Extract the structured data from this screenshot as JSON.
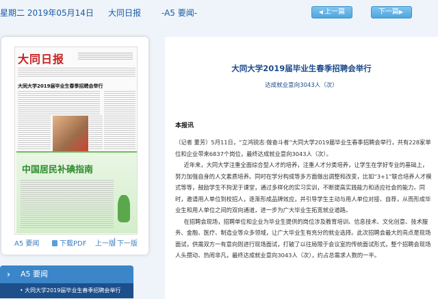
{
  "topbar": {
    "date": "星期二 2019年05月14日",
    "paper": "大同日报",
    "section": "-A5 要闻-",
    "prev_label": "上一篇",
    "next_label": "下一篇"
  },
  "thumbnail": {
    "masthead": "大同日报",
    "headline": "大同大学2019届毕业生春季招聘会举行",
    "ad_title": "中国居民补碘指南",
    "section_link": "A5 要闻",
    "pdf_link": "下载PDF",
    "prev_page": "上一版",
    "next_page": "下一版"
  },
  "section_list": {
    "header": "A5 要闻",
    "items": [
      "大同大学2019届毕业生春季招聘会举行"
    ]
  },
  "article": {
    "title": "大同大学2019届毕业生春季招聘会举行",
    "subtitle": "达成就业意向3043人（次）",
    "intro_label": "本报讯",
    "paragraphs": [
      "（记者 董芳）5月11日，“立鸿锐志·做奋斗者”大同大学2019届毕业生春季招聘会举行，共有228家单位和企业带来6837个岗位，最终达成就业意向3043人（次）。",
      "近年来，大同大学注重全面综合型人才的培养，注重人才分类培养，让学生在学好专业的基础上，努力加强自身的人文素质培养。同时在学分构成等多方面做出调整和改变，比如“3+1”联合培养人才模式等等，鼓励学生不拘泥于课堂，通过多样化的实习实训，不断提高实践能力和适应社会的能力。同时，邀请用人单位到校招人，逐渐形成品牌效应，并引导学生主动与用人单位对接、自荐，从而形成毕业生和用人单位之间的双向通道，进一步为广大毕业生拓宽就业道路。",
      "在招聘会现场，招聘单位和企业为毕业生提供的岗位涉及教育培训、信息技术、文化创意、技术服务、金融、医疗、制造业等众多领域，让广大毕业生有充分的就业选择。此次招聘会最大的亮点是现场面试，供需双方一有意向则进行现场面试，打破了以往局限于会议室的传统面试形式，整个招聘会现场人头攒动、热闹非凡，最终达成就业意向3043人（次），约占总需求人数的一半。"
    ]
  },
  "colors": {
    "accent": "#1a5aa6",
    "button": "#4ea6e0",
    "section_header": "#3b86c9",
    "section_item": "#1d4f8a"
  }
}
